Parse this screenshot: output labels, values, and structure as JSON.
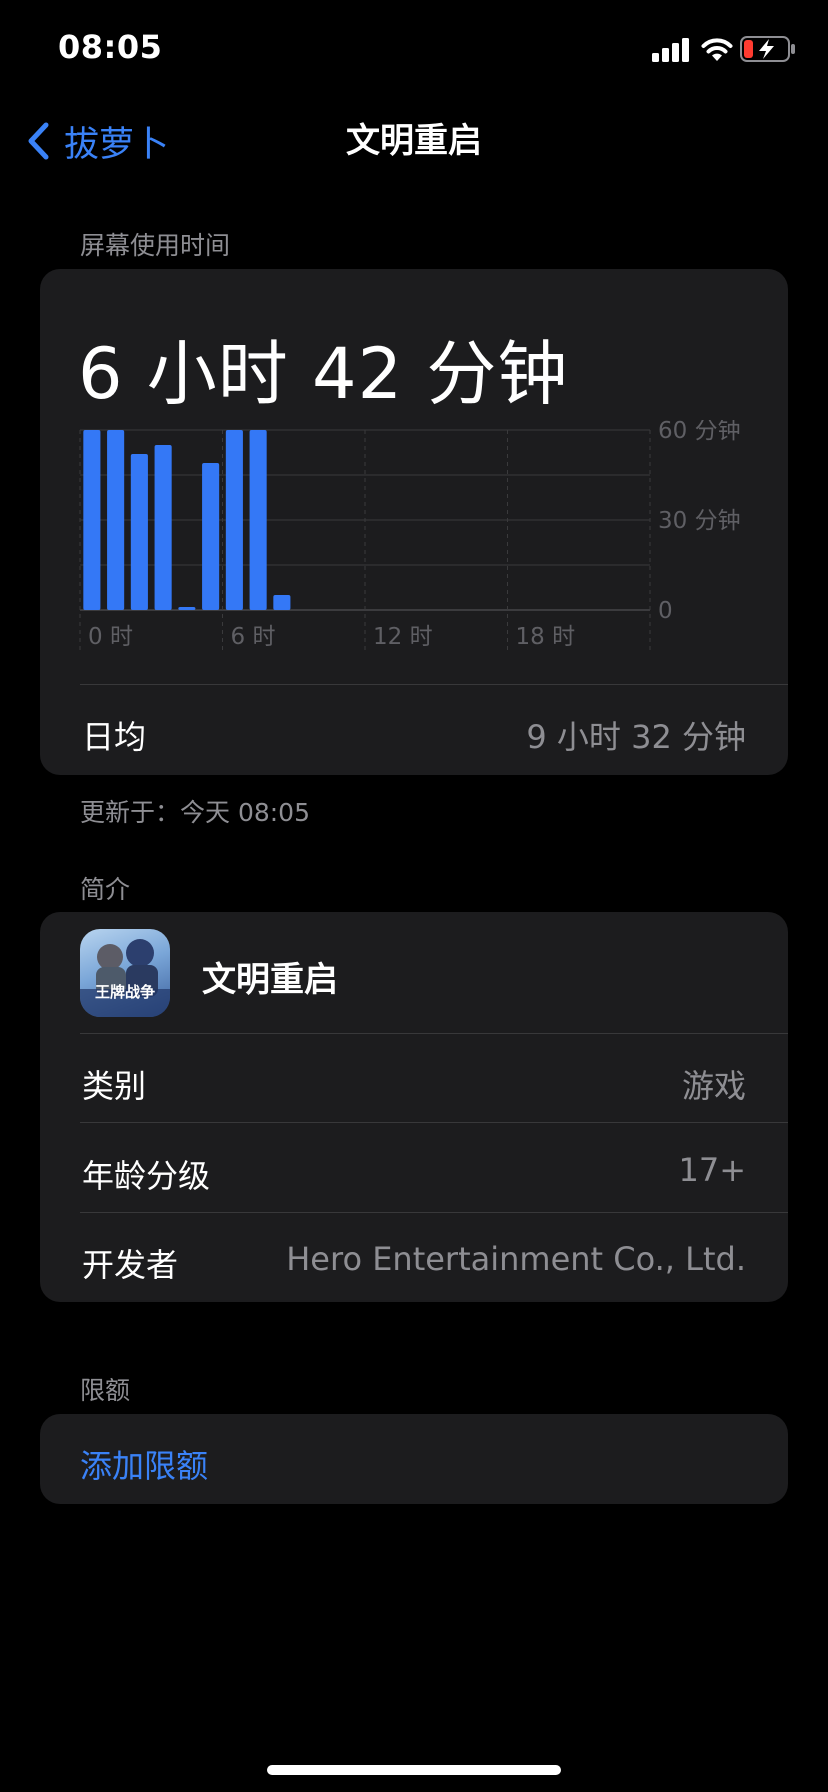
{
  "status_bar": {
    "time": "08:05"
  },
  "nav": {
    "back_label": "拔萝卜",
    "title": "文明重启"
  },
  "screen_time": {
    "section_label": "屏幕使用时间",
    "total": "6 小时 42 分钟",
    "daily_avg_label": "日均",
    "daily_avg_value": "9 小时 32 分钟",
    "updated": "更新于：今天 08:05"
  },
  "chart_data": {
    "type": "bar",
    "x_unit": "hour",
    "x": [
      0,
      1,
      2,
      3,
      4,
      5,
      6,
      7,
      8
    ],
    "values": [
      60,
      60,
      52,
      55,
      1,
      49,
      60,
      60,
      5
    ],
    "x_ticks": [
      "0 时",
      "6 时",
      "12 时",
      "18 时"
    ],
    "y_ticks": [
      "60 分钟",
      "30 分钟",
      "0"
    ],
    "ylim": [
      0,
      60
    ],
    "xlim": [
      0,
      24
    ],
    "grid": true,
    "colors": {
      "bar": "#3478f6"
    }
  },
  "intro": {
    "section_label": "简介",
    "app_name": "文明重启",
    "app_icon_text": "王牌战争",
    "category_label": "类别",
    "category_value": "游戏",
    "age_label": "年龄分级",
    "age_value": "17+",
    "developer_label": "开发者",
    "developer_value": "Hero Entertainment Co., Ltd."
  },
  "limits": {
    "section_label": "限额",
    "add_label": "添加限额"
  },
  "colors": {
    "accent": "#3a82f7",
    "card": "#1c1c1e",
    "secondary_text": "#8e8e93",
    "battery_low": "#ff3b30"
  }
}
